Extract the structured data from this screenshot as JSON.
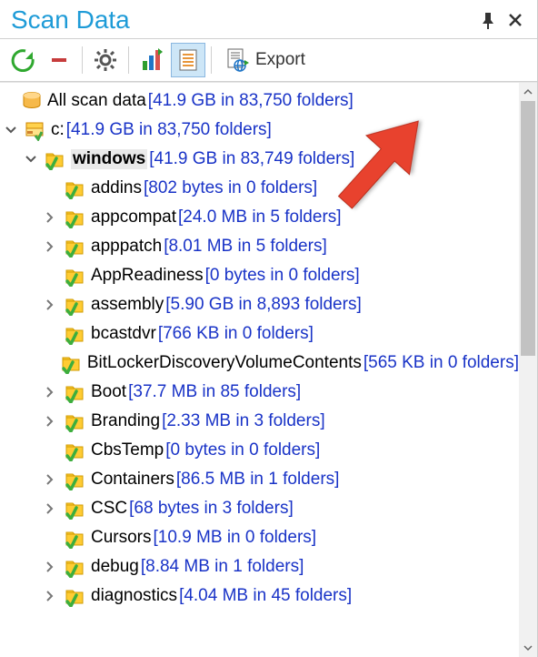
{
  "title": "Scan Data",
  "toolbar": {
    "export_label": "Export"
  },
  "root": {
    "name": "All scan data",
    "stats": "[41.9 GB in 83,750 folders]"
  },
  "drive": {
    "name": "c:",
    "stats": "[41.9 GB in 83,750 folders]"
  },
  "selected_folder": {
    "name": "windows",
    "stats": "[41.9 GB in 83,749 folders]"
  },
  "children": [
    {
      "name": "addins",
      "stats": "[802 bytes in 0 folders]",
      "expandable": false
    },
    {
      "name": "appcompat",
      "stats": "[24.0 MB in 5 folders]",
      "expandable": true
    },
    {
      "name": "apppatch",
      "stats": "[8.01 MB in 5 folders]",
      "expandable": true
    },
    {
      "name": "AppReadiness",
      "stats": "[0 bytes in 0 folders]",
      "expandable": false
    },
    {
      "name": "assembly",
      "stats": "[5.90 GB in 8,893 folders]",
      "expandable": true
    },
    {
      "name": "bcastdvr",
      "stats": "[766 KB in 0 folders]",
      "expandable": false
    },
    {
      "name": "BitLockerDiscoveryVolumeContents",
      "stats": "[565 KB in 0 folders]",
      "expandable": false
    },
    {
      "name": "Boot",
      "stats": "[37.7 MB in 85 folders]",
      "expandable": true
    },
    {
      "name": "Branding",
      "stats": "[2.33 MB in 3 folders]",
      "expandable": true
    },
    {
      "name": "CbsTemp",
      "stats": "[0 bytes in 0 folders]",
      "expandable": false
    },
    {
      "name": "Containers",
      "stats": "[86.5 MB in 1 folders]",
      "expandable": true
    },
    {
      "name": "CSC",
      "stats": "[68 bytes in 3 folders]",
      "expandable": true
    },
    {
      "name": "Cursors",
      "stats": "[10.9 MB in 0 folders]",
      "expandable": false
    },
    {
      "name": "debug",
      "stats": "[8.84 MB in 1 folders]",
      "expandable": true
    },
    {
      "name": "diagnostics",
      "stats": "[4.04 MB in 45 folders]",
      "expandable": true
    }
  ]
}
